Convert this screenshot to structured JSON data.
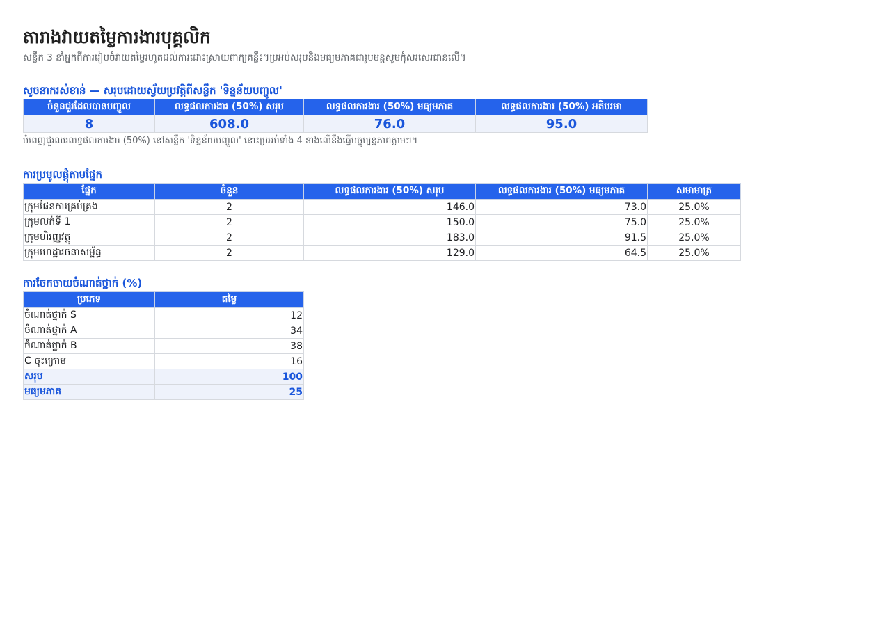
{
  "page": {
    "title": "តារាងវាយតម្លៃការងារបុគ្គលិក",
    "subtitle": "សន្លឹក 3 នាំអ្នកពីការរៀបចំវាយតម្លៃរហូតដល់ការដោះស្រាយពាក្យគន្លឹះ។ប្រអប់សរុបនិងមធ្យមភាគជារូបមន្តសូមកុំសរសេរជាន់លើ។"
  },
  "kpi": {
    "heading": "សូចនាករសំខាន់ — សរុបដោយស្វ័យប្រវត្តិពីសន្លឹក 'ទិន្នន័យបញ្ចូល'",
    "headers": [
      "ចំនួនជួរដែលបានបញ្ចូល",
      "លទ្ធផលការងារ (50%) សរុប",
      "លទ្ធផលការងារ (50%) មធ្យមភាគ",
      "លទ្ធផលការងារ (50%) អតិបរមា"
    ],
    "values": [
      "8",
      "608.0",
      "76.0",
      "95.0"
    ],
    "note": "បំពេញជួរឈរលទ្ធផលការងារ (50%) នៅសន្លឹក 'ទិន្នន័យបញ្ចូល' នោះប្រអប់ទាំង 4 ខាងលើនឹងធ្វើបច្ចុប្បន្នភាពភ្លាមៗ។"
  },
  "groups": {
    "heading": "ការប្រមូលផ្តុំតាមផ្នែក",
    "headers": [
      "ផ្នែក",
      "ចំនួន",
      "លទ្ធផលការងារ (50%) សរុប",
      "លទ្ធផលការងារ (50%) មធ្យមភាគ",
      "សមាមាត្រ"
    ],
    "rows": [
      [
        "ក្រុមផែនការគ្រប់គ្រង",
        "2",
        "146.0",
        "73.0",
        "25.0%"
      ],
      [
        "ក្រុមលក់ទី 1",
        "2",
        "150.0",
        "75.0",
        "25.0%"
      ],
      [
        "ក្រុមហិរញ្ញវត្ថុ",
        "2",
        "183.0",
        "91.5",
        "25.0%"
      ],
      [
        "ក្រុមហេដ្ឋារចនាសម្ព័ន្ធ",
        "2",
        "129.0",
        "64.5",
        "25.0%"
      ]
    ]
  },
  "distribution": {
    "heading": "ការចែកចាយចំណាត់ថ្នាក់ (%)",
    "headers": [
      "ប្រភេទ",
      "តម្លៃ"
    ],
    "rows": [
      [
        "ចំណាត់ថ្នាក់ S",
        "12"
      ],
      [
        "ចំណាត់ថ្នាក់ A",
        "34"
      ],
      [
        "ចំណាត់ថ្នាក់ B",
        "38"
      ],
      [
        "C ចុះក្រោម",
        "16"
      ]
    ],
    "summary": [
      [
        "សរុប",
        "100"
      ],
      [
        "មធ្យមភាគ",
        "25"
      ]
    ]
  },
  "colors": {
    "header_bg": "#2563eb",
    "accent_text": "#1a56db",
    "summary_bg": "#eef2fb"
  }
}
